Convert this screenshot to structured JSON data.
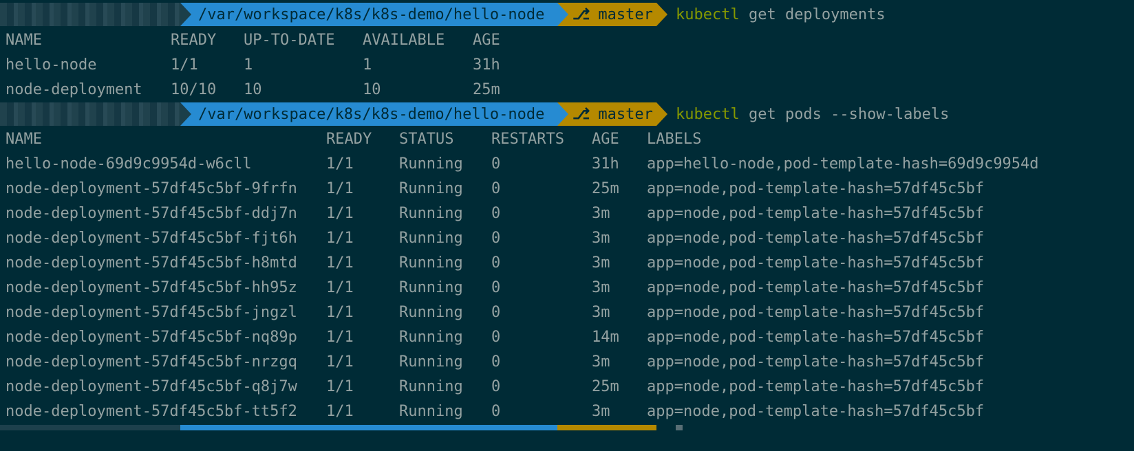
{
  "prompts": [
    {
      "path": "/var/workspace/k8s/k8s-demo/hello-node",
      "branch": "master",
      "command_bin": "kubectl",
      "command_args": " get deployments"
    },
    {
      "path": "/var/workspace/k8s/k8s-demo/hello-node",
      "branch": "master",
      "command_bin": "kubectl",
      "command_args": " get pods --show-labels"
    }
  ],
  "deployments": {
    "headers": [
      "NAME",
      "READY",
      "UP-TO-DATE",
      "AVAILABLE",
      "AGE"
    ],
    "rows": [
      [
        "hello-node",
        "1/1",
        "1",
        "1",
        "31h"
      ],
      [
        "node-deployment",
        "10/10",
        "10",
        "10",
        "25m"
      ]
    ]
  },
  "pods": {
    "headers": [
      "NAME",
      "READY",
      "STATUS",
      "RESTARTS",
      "AGE",
      "LABELS"
    ],
    "rows": [
      [
        "hello-node-69d9c9954d-w6cll",
        "1/1",
        "Running",
        "0",
        "31h",
        "app=hello-node,pod-template-hash=69d9c9954d"
      ],
      [
        "node-deployment-57df45c5bf-9frfn",
        "1/1",
        "Running",
        "0",
        "25m",
        "app=node,pod-template-hash=57df45c5bf"
      ],
      [
        "node-deployment-57df45c5bf-ddj7n",
        "1/1",
        "Running",
        "0",
        "3m",
        "app=node,pod-template-hash=57df45c5bf"
      ],
      [
        "node-deployment-57df45c5bf-fjt6h",
        "1/1",
        "Running",
        "0",
        "3m",
        "app=node,pod-template-hash=57df45c5bf"
      ],
      [
        "node-deployment-57df45c5bf-h8mtd",
        "1/1",
        "Running",
        "0",
        "3m",
        "app=node,pod-template-hash=57df45c5bf"
      ],
      [
        "node-deployment-57df45c5bf-hh95z",
        "1/1",
        "Running",
        "0",
        "3m",
        "app=node,pod-template-hash=57df45c5bf"
      ],
      [
        "node-deployment-57df45c5bf-jngzl",
        "1/1",
        "Running",
        "0",
        "3m",
        "app=node,pod-template-hash=57df45c5bf"
      ],
      [
        "node-deployment-57df45c5bf-nq89p",
        "1/1",
        "Running",
        "0",
        "14m",
        "app=node,pod-template-hash=57df45c5bf"
      ],
      [
        "node-deployment-57df45c5bf-nrzgq",
        "1/1",
        "Running",
        "0",
        "3m",
        "app=node,pod-template-hash=57df45c5bf"
      ],
      [
        "node-deployment-57df45c5bf-q8j7w",
        "1/1",
        "Running",
        "0",
        "25m",
        "app=node,pod-template-hash=57df45c5bf"
      ],
      [
        "node-deployment-57df45c5bf-tt5f2",
        "1/1",
        "Running",
        "0",
        "3m",
        "app=node,pod-template-hash=57df45c5bf"
      ]
    ]
  },
  "colors": {
    "background": "#002b36",
    "text": "#93a1a1",
    "path_segment": "#268bd2",
    "branch_segment": "#b58900",
    "command": "#859900"
  },
  "icons": {
    "branch": "git-branch-icon"
  }
}
